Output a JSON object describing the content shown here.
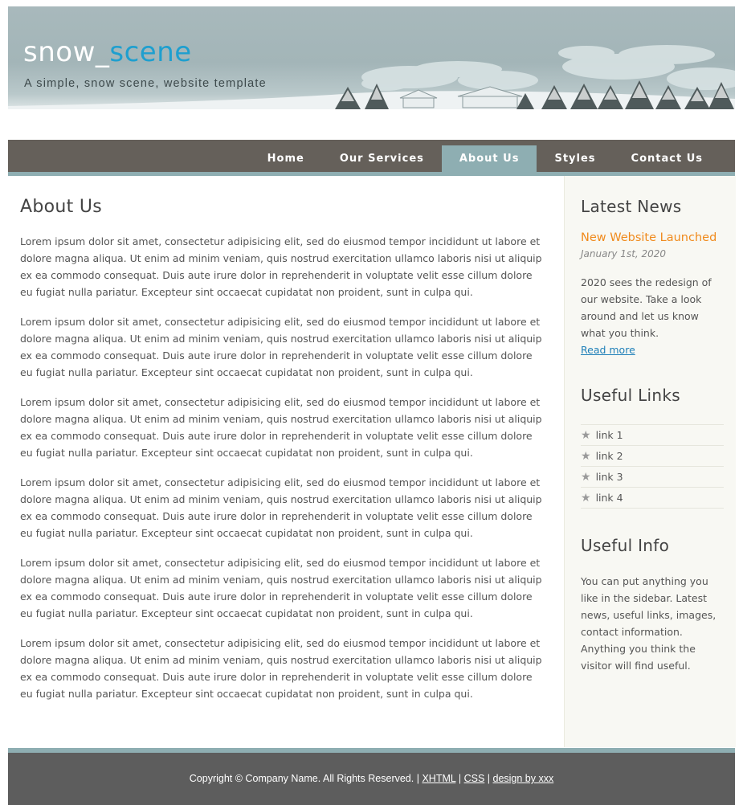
{
  "header": {
    "logo_part1": "snow_",
    "logo_part2": "scene",
    "slogan": "A simple, snow scene, website template"
  },
  "nav": {
    "items": [
      "Home",
      "Our Services",
      "About Us",
      "Styles",
      "Contact Us"
    ],
    "selected": "About Us"
  },
  "main": {
    "title": "About Us",
    "paragraphs": [
      "Lorem ipsum dolor sit amet, consectetur adipisicing elit, sed do eiusmod tempor incididunt ut labore et dolore magna aliqua. Ut enim ad minim veniam, quis nostrud exercitation ullamco laboris nisi ut aliquip ex ea commodo consequat. Duis aute irure dolor in reprehenderit in voluptate velit esse cillum dolore eu fugiat nulla pariatur. Excepteur sint occaecat cupidatat non proident, sunt in culpa qui.",
      "Lorem ipsum dolor sit amet, consectetur adipisicing elit, sed do eiusmod tempor incididunt ut labore et dolore magna aliqua. Ut enim ad minim veniam, quis nostrud exercitation ullamco laboris nisi ut aliquip ex ea commodo consequat. Duis aute irure dolor in reprehenderit in voluptate velit esse cillum dolore eu fugiat nulla pariatur. Excepteur sint occaecat cupidatat non proident, sunt in culpa qui.",
      "Lorem ipsum dolor sit amet, consectetur adipisicing elit, sed do eiusmod tempor incididunt ut labore et dolore magna aliqua. Ut enim ad minim veniam, quis nostrud exercitation ullamco laboris nisi ut aliquip ex ea commodo consequat. Duis aute irure dolor in reprehenderit in voluptate velit esse cillum dolore eu fugiat nulla pariatur. Excepteur sint occaecat cupidatat non proident, sunt in culpa qui.",
      "Lorem ipsum dolor sit amet, consectetur adipisicing elit, sed do eiusmod tempor incididunt ut labore et dolore magna aliqua. Ut enim ad minim veniam, quis nostrud exercitation ullamco laboris nisi ut aliquip ex ea commodo consequat. Duis aute irure dolor in reprehenderit in voluptate velit esse cillum dolore eu fugiat nulla pariatur. Excepteur sint occaecat cupidatat non proident, sunt in culpa qui.",
      "Lorem ipsum dolor sit amet, consectetur adipisicing elit, sed do eiusmod tempor incididunt ut labore et dolore magna aliqua. Ut enim ad minim veniam, quis nostrud exercitation ullamco laboris nisi ut aliquip ex ea commodo consequat. Duis aute irure dolor in reprehenderit in voluptate velit esse cillum dolore eu fugiat nulla pariatur. Excepteur sint occaecat cupidatat non proident, sunt in culpa qui.",
      "Lorem ipsum dolor sit amet, consectetur adipisicing elit, sed do eiusmod tempor incididunt ut labore et dolore magna aliqua. Ut enim ad minim veniam, quis nostrud exercitation ullamco laboris nisi ut aliquip ex ea commodo consequat. Duis aute irure dolor in reprehenderit in voluptate velit esse cillum dolore eu fugiat nulla pariatur. Excepteur sint occaecat cupidatat non proident, sunt in culpa qui."
    ]
  },
  "sidebar": {
    "news": {
      "heading": "Latest News",
      "title": "New Website Launched",
      "date": "January 1st, 2020",
      "body": "2020 sees the redesign of our website. Take a look around and let us know what you think.",
      "read_more": "Read more"
    },
    "links": {
      "heading": "Useful Links",
      "icon": "star-icon",
      "items": [
        "link 1",
        "link 2",
        "link 3",
        "link 4"
      ]
    },
    "info": {
      "heading": "Useful Info",
      "body": "You can put anything you like in the sidebar. Latest news, useful links, images, contact information. Anything you think the visitor will find useful."
    }
  },
  "footer": {
    "copyright": "Copyright © Company Name. All Rights Reserved.",
    "sep": "|",
    "link1": "XHTML",
    "link2": "CSS",
    "link3": "design by xxx"
  },
  "colors": {
    "accent": "#1e9fcf",
    "nav_bg": "#65605a",
    "nav_selected": "#8eaeb2",
    "news_title": "#f08a1c",
    "footer_bg": "#5d5d5d"
  }
}
